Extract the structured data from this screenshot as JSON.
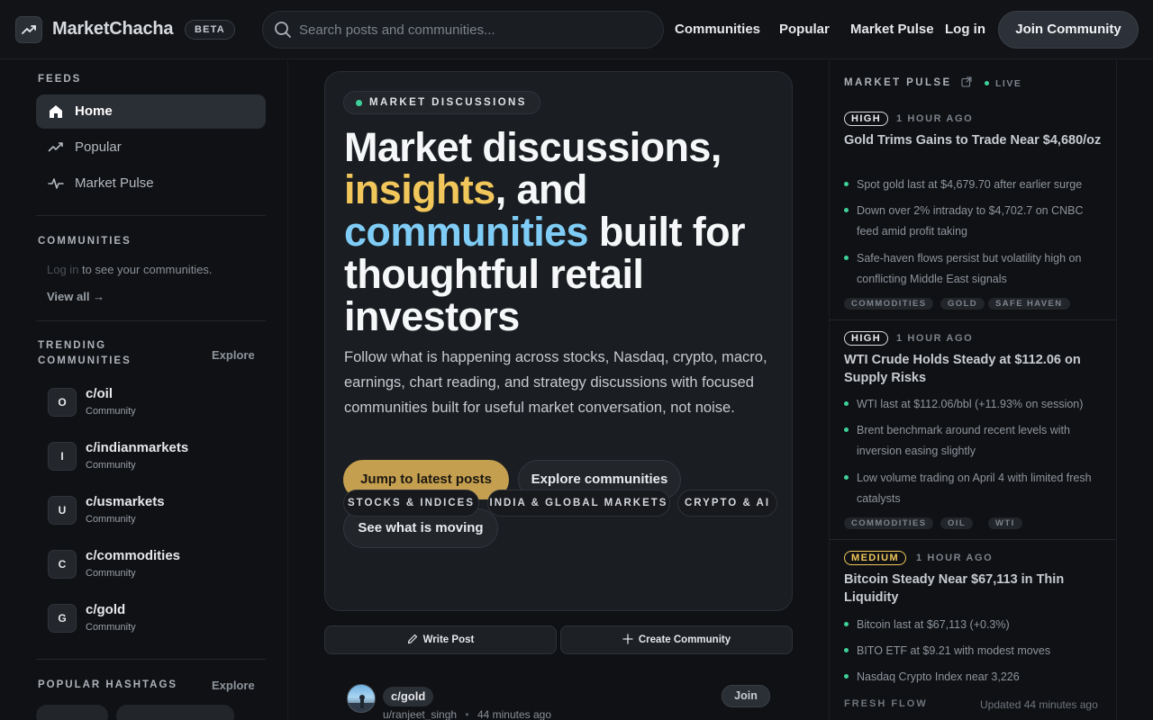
{
  "header": {
    "brand": "MarketChacha",
    "beta": "BETA",
    "search_placeholder": "Search posts and communities...",
    "nav": [
      "Communities",
      "Popular",
      "Market Pulse"
    ],
    "login": "Log in",
    "join": "Join Community"
  },
  "sidebar": {
    "feeds_label": "FEEDS",
    "feeds": [
      {
        "label": "Home",
        "icon": "home-icon",
        "active": true
      },
      {
        "label": "Popular",
        "icon": "trending-icon",
        "active": false
      },
      {
        "label": "Market Pulse",
        "icon": "pulse-icon",
        "active": false
      }
    ],
    "communities_label": "COMMUNITIES",
    "login_link": "Log in",
    "login_suffix": " to see your communities.",
    "view_all": "View all →",
    "trending_label_1": "TRENDING",
    "trending_label_2": "COMMUNITIES",
    "trending_explore": "Explore",
    "trending": [
      {
        "initial": "O",
        "name": "c/oil",
        "sub": "Community"
      },
      {
        "initial": "I",
        "name": "c/indianmarkets",
        "sub": "Community"
      },
      {
        "initial": "U",
        "name": "c/usmarkets",
        "sub": "Community"
      },
      {
        "initial": "C",
        "name": "c/commodities",
        "sub": "Community"
      },
      {
        "initial": "G",
        "name": "c/gold",
        "sub": "Community"
      }
    ],
    "hashtags_label": "POPULAR HASHTAGS",
    "hashtags_explore": "Explore"
  },
  "hero": {
    "tag": "MARKET DISCUSSIONS",
    "title_1": "Market discussions,",
    "title_gold": "insights",
    "title_2": ", and",
    "title_blue": "communities",
    "title_3": " built for thoughtful retail investors",
    "description": "Follow what is happening across stocks, Nasdaq, crypto, macro, earnings, chart reading, and strategy discussions with focused communities built for useful market conversation, not noise.",
    "cta_primary": "Jump to latest posts",
    "cta_secondary": "Explore communities",
    "cta_tertiary": "See what is moving",
    "topics": [
      "STOCKS & INDICES",
      "INDIA & GLOBAL MARKETS",
      "CRYPTO & AI"
    ]
  },
  "actions": {
    "write_post": "Write Post",
    "create_community": "Create Community"
  },
  "post": {
    "community": "c/gold",
    "author": "u/ranjeet_singh",
    "time": "44 minutes ago",
    "join": "Join"
  },
  "pulse": {
    "label": "MARKET PULSE",
    "live": "LIVE",
    "items": [
      {
        "priority": "HIGH",
        "ago": "1 HOUR AGO",
        "title": "Gold Trims Gains to Trade Near $4,680/oz",
        "bullets": [
          "Spot gold last at $4,679.70 after earlier surge",
          "Down over 2% intraday to $4,702.7 on CNBC feed amid profit taking",
          "Safe-haven flows persist but volatility high on conflicting Middle East signals"
        ],
        "tags": [
          "COMMODITIES",
          "GOLD",
          "SAFE HAVEN"
        ]
      },
      {
        "priority": "HIGH",
        "ago": "1 HOUR AGO",
        "title": "WTI Crude Holds Steady at $112.06 on Supply Risks",
        "bullets": [
          "WTI last at $112.06/bbl (+11.93% on session)",
          "Brent benchmark around recent levels with inversion easing slightly",
          "Low volume trading on April 4 with limited fresh catalysts"
        ],
        "tags": [
          "COMMODITIES",
          "OIL",
          "WTI"
        ]
      },
      {
        "priority": "MEDIUM",
        "ago": "1 HOUR AGO",
        "title": "Bitcoin Steady Near $67,113 in Thin Liquidity",
        "bullets": [
          "Bitcoin last at $67,113 (+0.3%)",
          "BITO ETF at $9.21 with modest moves",
          "Nasdaq Crypto Index near 3,226"
        ],
        "tags": []
      }
    ],
    "fresh": "FRESH FLOW",
    "updated": "Updated 44 minutes ago"
  },
  "colors": {
    "background": "#0f1114",
    "panel": "#1a1d21",
    "accent_gold": "#f1c75b",
    "accent_blue": "#7fcdf7",
    "live_green": "#3ed19a",
    "primary_button": "#c49f4f"
  }
}
